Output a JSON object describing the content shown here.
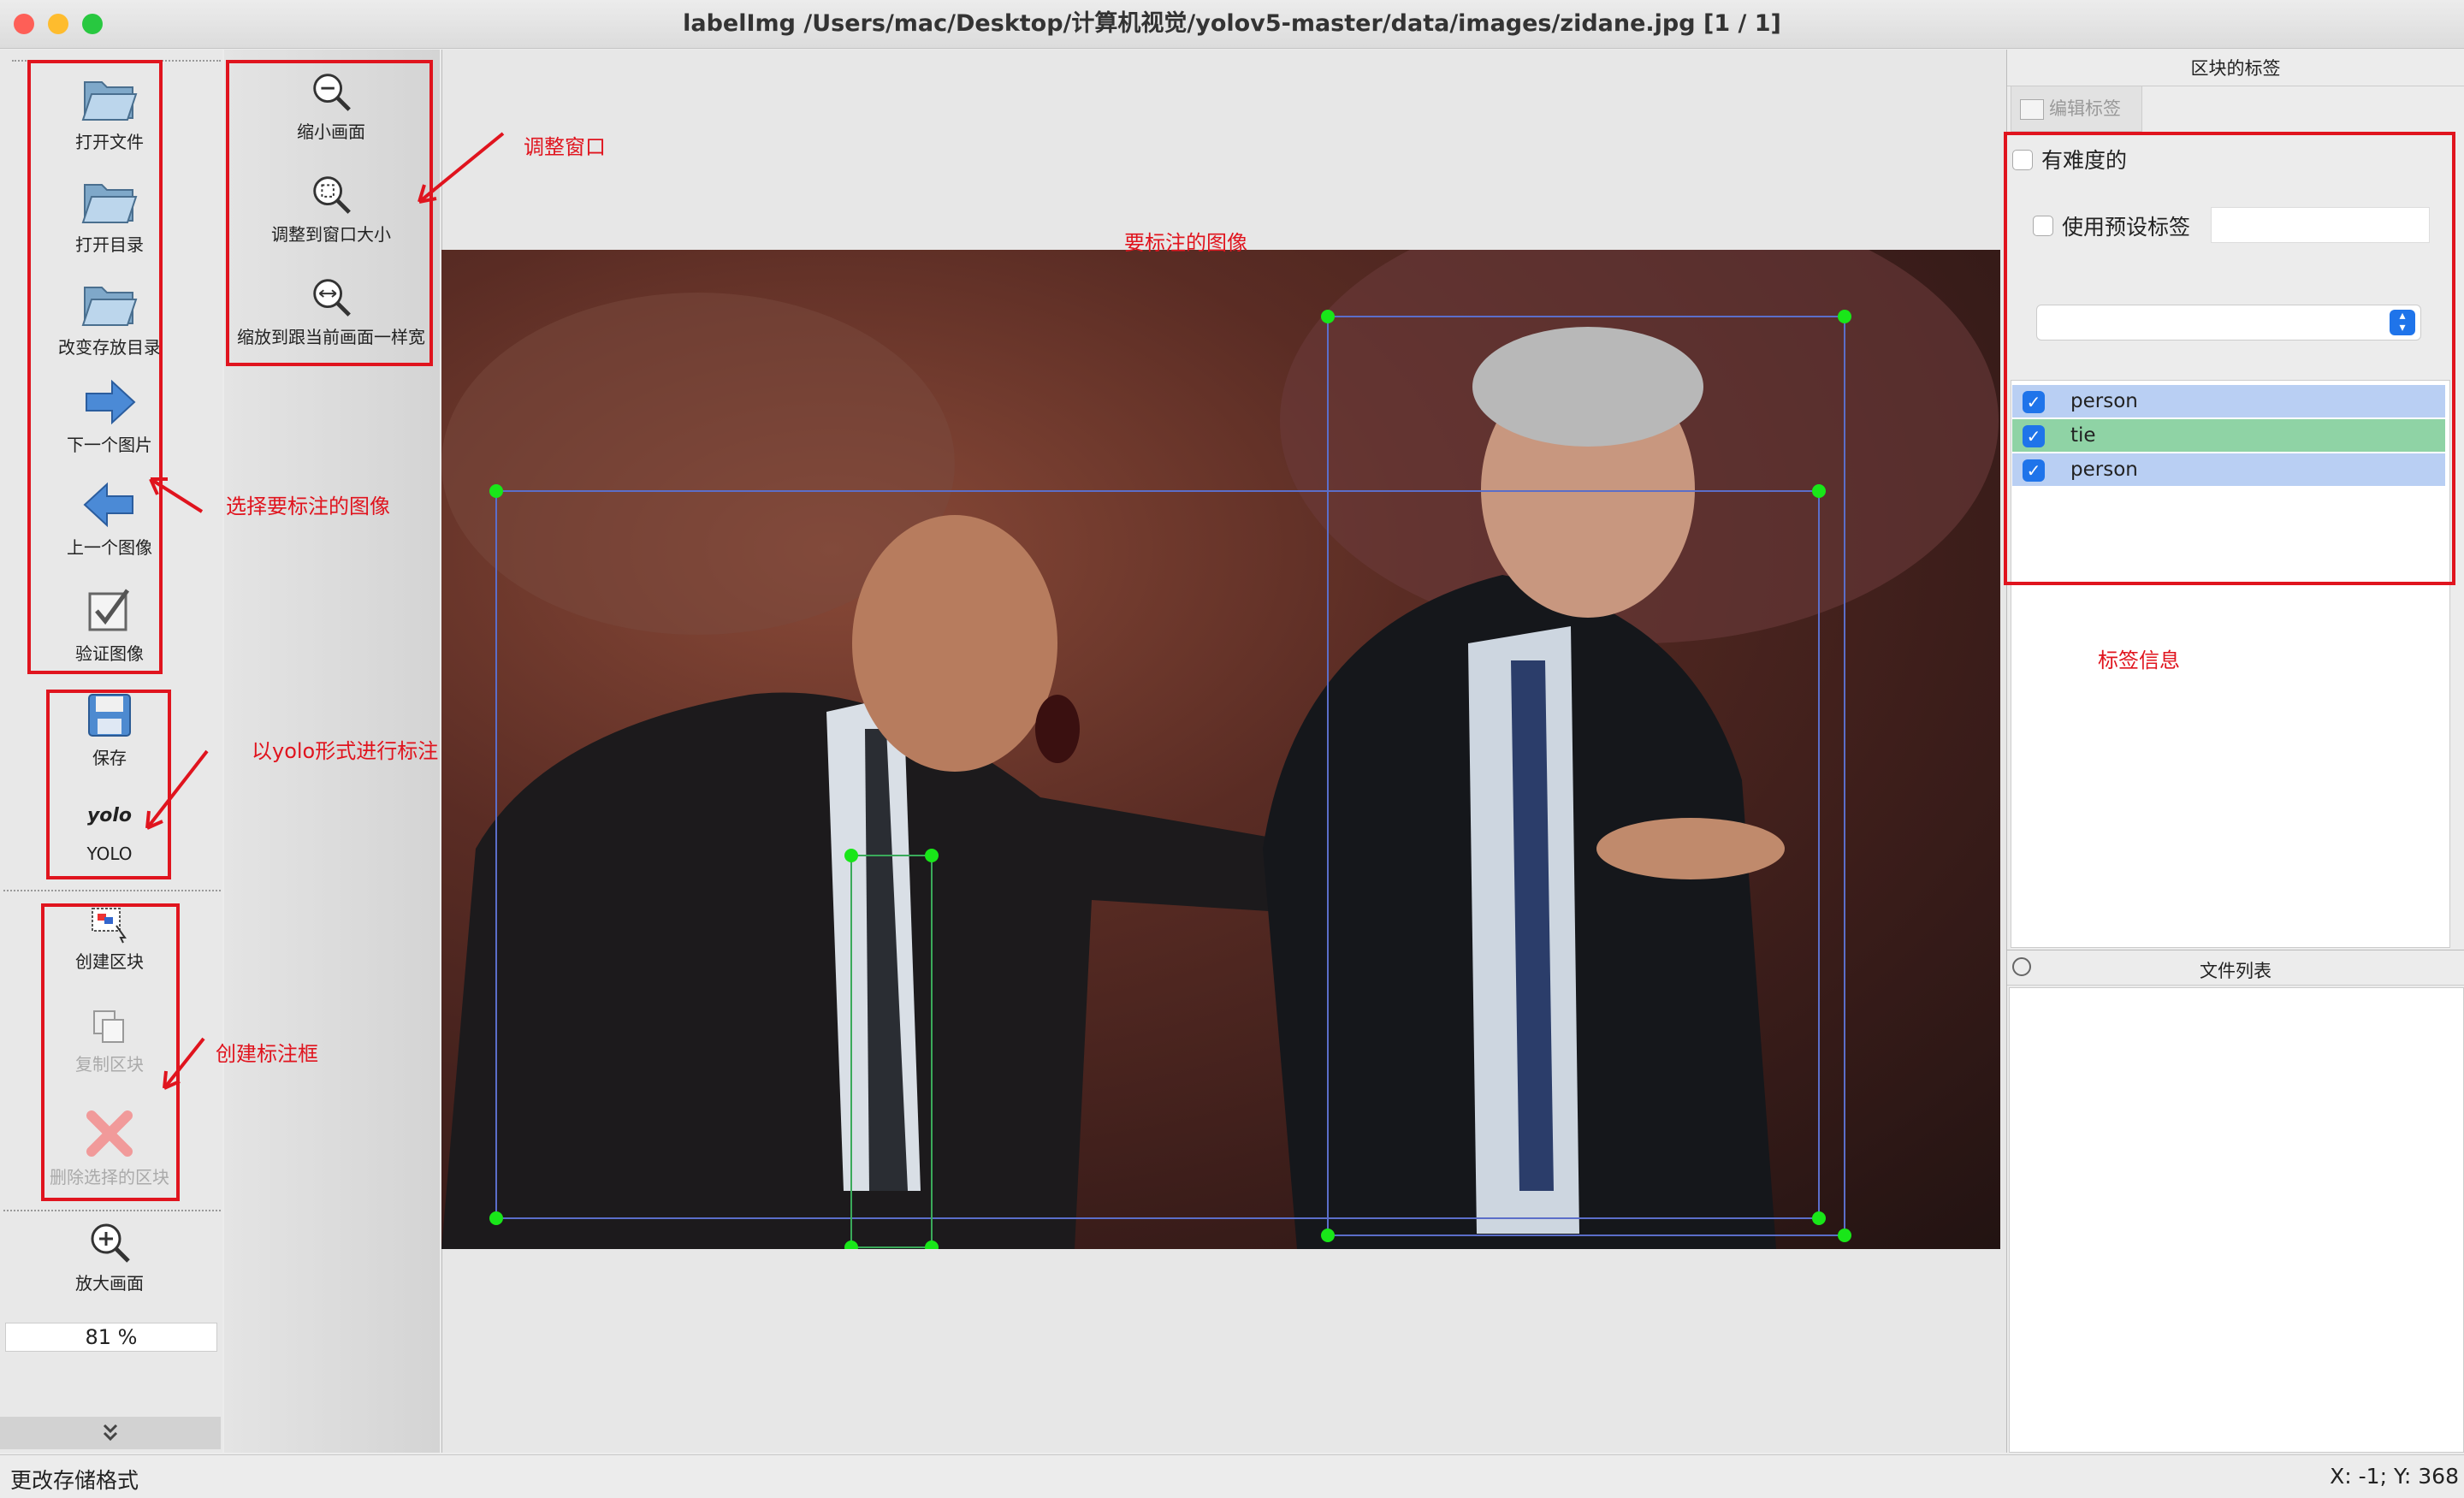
{
  "window": {
    "title": "labelImg /Users/mac/Desktop/计算机视觉/yolov5-master/data/images/zidane.jpg [1 / 1]"
  },
  "toolbar_left": {
    "open_file": "打开文件",
    "open_dir": "打开目录",
    "change_save_dir": "改变存放目录",
    "next_image": "下一个图片",
    "prev_image": "上一个图像",
    "verify_image": "验证图像",
    "save": "保存",
    "yolo_icon_text": "yolo",
    "yolo": "YOLO",
    "create_box": "创建区块",
    "duplicate_box": "复制区块",
    "delete_box": "删除选择的区块",
    "zoom_in": "放大画面",
    "zoom_value": "81 %"
  },
  "toolbar_zoom": {
    "zoom_out": "缩小画面",
    "fit_window": "调整到窗口大小",
    "fit_width": "缩放到跟当前画面一样宽"
  },
  "annotations": {
    "adjust_window": "调整窗口",
    "image_to_label": "要标注的图像",
    "select_image": "选择要标注的图像",
    "yolo_format": "以yolo形式进行标注",
    "create_box": "创建标注框",
    "label_info": "标签信息"
  },
  "right_panel": {
    "box_labels_title": "区块的标签",
    "edit_label_button": "编辑标签",
    "difficult": "有难度的",
    "use_default_label": "使用预设标签",
    "default_label_value": "",
    "labels": [
      {
        "name": "person",
        "checked": true,
        "color": "#b9cff3"
      },
      {
        "name": "tie",
        "checked": true,
        "color": "#8fd3a5"
      },
      {
        "name": "person",
        "checked": true,
        "color": "#b9cff3"
      }
    ],
    "file_list_title": "文件列表"
  },
  "status": {
    "left": "更改存储格式",
    "right": "X: -1; Y: 368"
  },
  "colors": {
    "annotation_red": "#e0141e",
    "box_line": "#5b6ec9",
    "vertex": "#19e619"
  }
}
